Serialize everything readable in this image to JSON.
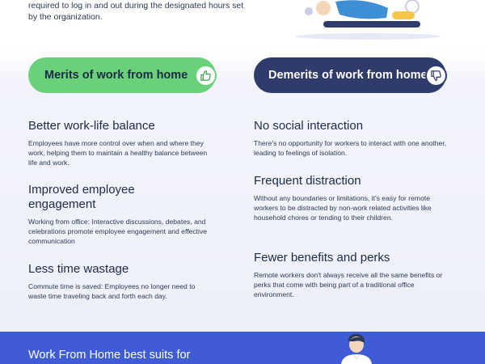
{
  "intro": {
    "line1": "required to log in and out during the designated hours set",
    "line2": "by the organization."
  },
  "merits": {
    "label": "Merits of work from home",
    "icon": "thumbs-up-icon",
    "color": "#6ad17a",
    "items": [
      {
        "title": "Better work-life balance",
        "text": "Employees have more control over when and where they work, helping them to maintain a healthy balance between life and work."
      },
      {
        "title": "Improved employee engagement",
        "text": "Working from office: Interactive discussions, debates, and celebrations promote employee engagement and effective communication"
      },
      {
        "title": "Less time wastage",
        "text": "Commute time is saved: Employees no longer need to waste time traveling back and forth each day."
      }
    ]
  },
  "demerits": {
    "label": "Demerits of work from home",
    "icon": "thumbs-down-icon",
    "color": "#2f3c6b",
    "items": [
      {
        "title": "No social interaction",
        "text": "There's no opportunity for workers to interact with one another, leading to feelings of isolation."
      },
      {
        "title": "Frequent distraction",
        "text": "Without any boundaries or limitations, it's easy for remote workers to be distracted by non-work related activities like household chores or tending to their children."
      },
      {
        "title": "Fewer benefits and perks",
        "text": "Remote workers don't always receive all the same benefits or perks that come with being part of a traditional office environment."
      }
    ]
  },
  "bottom": {
    "title": "Work From Home best suits for",
    "color": "#3f5bd6"
  }
}
